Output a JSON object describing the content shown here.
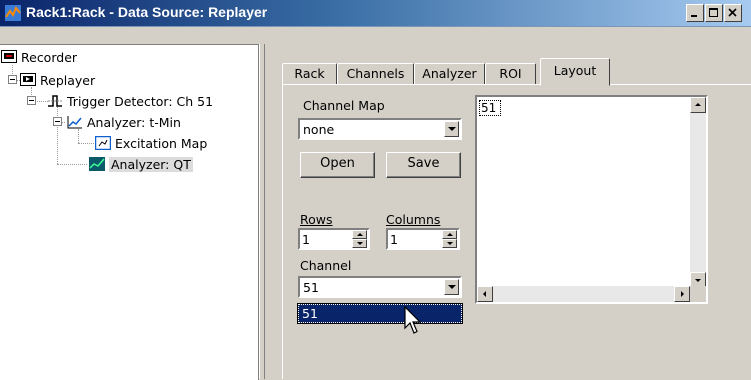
{
  "window": {
    "title": "Rack1:Rack - Data Source: Replayer",
    "colors": {
      "title_start": "#0a246a",
      "title_end": "#a6caf0",
      "face": "#d4d0c8",
      "highlight": "#0a246a"
    }
  },
  "tree": {
    "items": [
      {
        "label": "Recorder",
        "icon": "recorder-icon"
      },
      {
        "label": "Replayer",
        "icon": "replayer-icon"
      },
      {
        "label": "Trigger Detector: Ch 51",
        "icon": "trigger-detector-icon"
      },
      {
        "label": "Analyzer: t-Min",
        "icon": "analyzer-icon"
      },
      {
        "label": "Excitation Map",
        "icon": "excitation-map-icon"
      },
      {
        "label": "Analyzer: QT",
        "icon": "analyzer-qt-icon",
        "selected": true
      }
    ]
  },
  "tabs": [
    {
      "label": "Rack"
    },
    {
      "label": "Channels"
    },
    {
      "label": "Analyzer"
    },
    {
      "label": "ROI"
    },
    {
      "label": "Layout",
      "active": true
    }
  ],
  "layout_tab": {
    "channel_map_label": "Channel Map",
    "channel_map_value": "none",
    "open_label": "Open",
    "save_label": "Save",
    "rows_label": "Rows",
    "rows_value": "1",
    "columns_label": "Columns",
    "columns_value": "1",
    "channel_label": "Channel",
    "channel_value": "51",
    "channel_dropdown_options": [
      "51"
    ],
    "grid_cell_label": "51"
  }
}
